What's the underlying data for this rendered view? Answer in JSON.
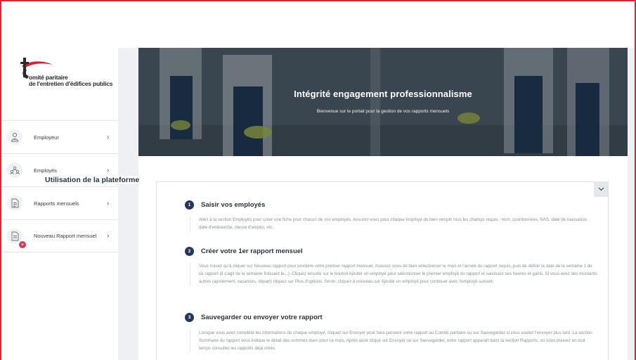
{
  "sidebar": {
    "logo": {
      "line1": "omité paritaire",
      "line2": "de l'entretien d'édifices publics"
    },
    "items": [
      {
        "label": "Employeur",
        "icon": "person-tie-icon"
      },
      {
        "label": "Employés",
        "icon": "people-group-icon"
      },
      {
        "label": "Rapports mensuels",
        "icon": "document-report-icon"
      },
      {
        "label": "Nouveau Rapport mensuel",
        "icon": "new-document-icon",
        "badge": "+"
      }
    ],
    "chevron": "›"
  },
  "hero": {
    "title": "Intégrité engagement professionnalisme",
    "subtitle": "Bienvenue sur le portail pour la gestion de vos rapports mensuels"
  },
  "section": {
    "title": "Utilisation de la plateforme",
    "collapse_icon": "chevron-down-icon"
  },
  "steps": [
    {
      "num": "1",
      "title": "Saisir vos employés",
      "text": "Allez à la section Employés pour créer une fiche pour chacun de vos employés. Assurez-vous pour chaque employé de bien remplir tous les champs requis : nom, coordonnées, NAS, date de naissance, date d'embauche, classe d'emploi, etc."
    },
    {
      "num": "2",
      "title": "Créer votre 1er rapport mensuel",
      "text": "Vous n'avez qu'à cliquer sur Nouveau rapport pour produire votre premier rapport mensuel. Assurez-vous de bien sélectionner le mois et l'année du rapport requis, puis de définir la date de la semaine 1 de ce rapport (il s'agit de la semaine finissant le...). Cliquez ensuite sur le bouton Ajouter un employé pour sélectionner le premier employé du rapport et saisissez ses heures et gains. Si vous avez des montants autres (ajustement, vacances, départ) cliquez sur Plus d'options. Sinon, cliquez à nouveau sur Ajouter un employé pour continuer avec l'employé suivant."
    },
    {
      "num": "3",
      "title": "Sauvegarder ou envoyer votre rapport",
      "text": "Lorsque vous avez complété les informations de chaque employé, cliquez sur Envoyer pour faire parvenir votre rapport au Comité paritaire ou sur Sauvegarder si vous voulez l'envoyer plus tard. La section Sommaire du rapport vous indique le détail des sommes dues pour ce mois. Après avoir cliqué sur Envoyer ou sur Sauvegarder, votre rapport apparaît dans la section Rapports, où vous pouvez en tout temps consulter les rapports déjà créés."
    }
  ],
  "colors": {
    "frame": "#e0262d",
    "step_badge": "#24365b",
    "alert_badge": "#e3344a"
  }
}
